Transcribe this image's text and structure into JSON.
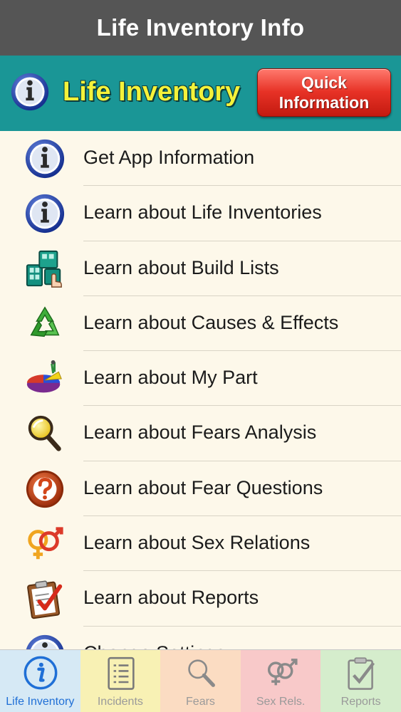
{
  "navbar": {
    "title": "Life Inventory Info"
  },
  "header": {
    "title": "Life Inventory",
    "quick_button": {
      "line1": "Quick",
      "line2": "Information"
    }
  },
  "items": [
    {
      "label": "Get App Information",
      "icon": "info-icon"
    },
    {
      "label": "Learn about Life Inventories",
      "icon": "info-icon"
    },
    {
      "label": "Learn about Build Lists",
      "icon": "build-lists-icon"
    },
    {
      "label": "Learn about Causes & Effects",
      "icon": "recycle-icon"
    },
    {
      "label": "Learn about My Part",
      "icon": "pie-chart-icon"
    },
    {
      "label": "Learn about Fears Analysis",
      "icon": "magnifier-icon"
    },
    {
      "label": "Learn about Fear Questions",
      "icon": "question-icon"
    },
    {
      "label": "Learn about Sex Relations",
      "icon": "gender-icon"
    },
    {
      "label": "Learn about Reports",
      "icon": "clipboard-icon"
    },
    {
      "label": "Change Settings",
      "icon": "info-icon"
    }
  ],
  "tabs": [
    {
      "label": "Life Inventory",
      "icon": "info-icon",
      "bg": "#d6e9f5",
      "color": "#1f6fd6",
      "selected": true
    },
    {
      "label": "Incidents",
      "icon": "list-icon",
      "bg": "#f8f1b4",
      "color": "#9a9a9a",
      "selected": false
    },
    {
      "label": "Fears",
      "icon": "magnifier-icon",
      "bg": "#fbdcc2",
      "color": "#9a9a9a",
      "selected": false
    },
    {
      "label": "Sex Rels.",
      "icon": "gender-icon",
      "bg": "#f8c9c9",
      "color": "#9a9a9a",
      "selected": false
    },
    {
      "label": "Reports",
      "icon": "clipboard-icon",
      "bg": "#d5edcc",
      "color": "#9a9a9a",
      "selected": false
    }
  ],
  "colors": {
    "navbar": "#555555",
    "header": "#1a9696",
    "header_title": "#f4f23a",
    "quick_button": "#e73226",
    "list_bg": "#fdf8ea"
  }
}
